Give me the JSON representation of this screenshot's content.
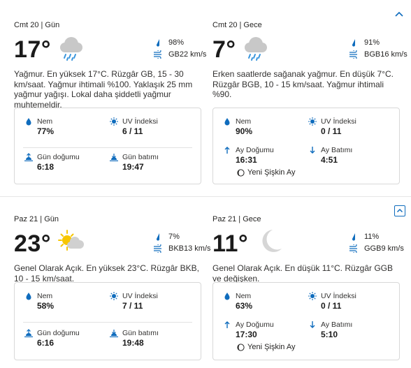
{
  "days": [
    {
      "day": {
        "header": "Cmt 20 | Gün",
        "temp": "17°",
        "icon": "rain-cloud-icon",
        "precip": "98%",
        "wind": "GB22 km/s",
        "description": "Yağmur. En yüksek 17°C. Rüzgâr GB, 15 - 30 km/saat. Yağmur ihtimali %100. Yaklaşık 25 mm yağmur yağışı. Lokal daha şiddetli yağmur muhtemeldir.",
        "details": {
          "humidity_label": "Nem",
          "humidity": "77%",
          "uv_label": "UV İndeksi",
          "uv": "6 / 11",
          "rise_label": "Gün doğumu",
          "rise": "6:18",
          "set_label": "Gün batımı",
          "set": "19:47"
        }
      },
      "night": {
        "header": "Cmt 20 | Gece",
        "temp": "7°",
        "icon": "rain-cloud-icon",
        "precip": "91%",
        "wind": "BGB16 km/s",
        "description": "Erken saatlerde sağanak yağmur. En düşük 7°C. Rüzgâr BGB, 10 - 15 km/saat. Yağmur ihtimali %90.",
        "details": {
          "humidity_label": "Nem",
          "humidity": "90%",
          "uv_label": "UV İndeksi",
          "uv": "0 / 11",
          "rise_label": "Ay Doğumu",
          "rise": "16:31",
          "set_label": "Ay Batımı",
          "set": "4:51",
          "moon_phase": "Yeni Şişkin Ay"
        }
      }
    },
    {
      "day": {
        "header": "Paz 21 | Gün",
        "temp": "23°",
        "icon": "partly-sunny-icon",
        "precip": "7%",
        "wind": "BKB13 km/s",
        "description": "Genel Olarak Açık. En yüksek 23°C. Rüzgâr BKB, 10 - 15 km/saat.",
        "details": {
          "humidity_label": "Nem",
          "humidity": "58%",
          "uv_label": "UV İndeksi",
          "uv": "7 / 11",
          "rise_label": "Gün doğumu",
          "rise": "6:16",
          "set_label": "Gün batımı",
          "set": "19:48"
        }
      },
      "night": {
        "header": "Paz 21 | Gece",
        "temp": "11°",
        "icon": "clear-night-moon-icon",
        "precip": "11%",
        "wind": "GGB9 km/s",
        "description": "Genel Olarak Açık. En düşük 11°C. Rüzgâr GGB ve değişken.",
        "details": {
          "humidity_label": "Nem",
          "humidity": "63%",
          "uv_label": "UV İndeksi",
          "uv": "0 / 11",
          "rise_label": "Ay Doğumu",
          "rise": "17:30",
          "set_label": "Ay Batımı",
          "set": "5:10",
          "moon_phase": "Yeni Şişkin Ay"
        }
      }
    }
  ],
  "colors": {
    "accent": "#0f6cbd",
    "text": "#252423",
    "border": "#d8d8d8"
  }
}
